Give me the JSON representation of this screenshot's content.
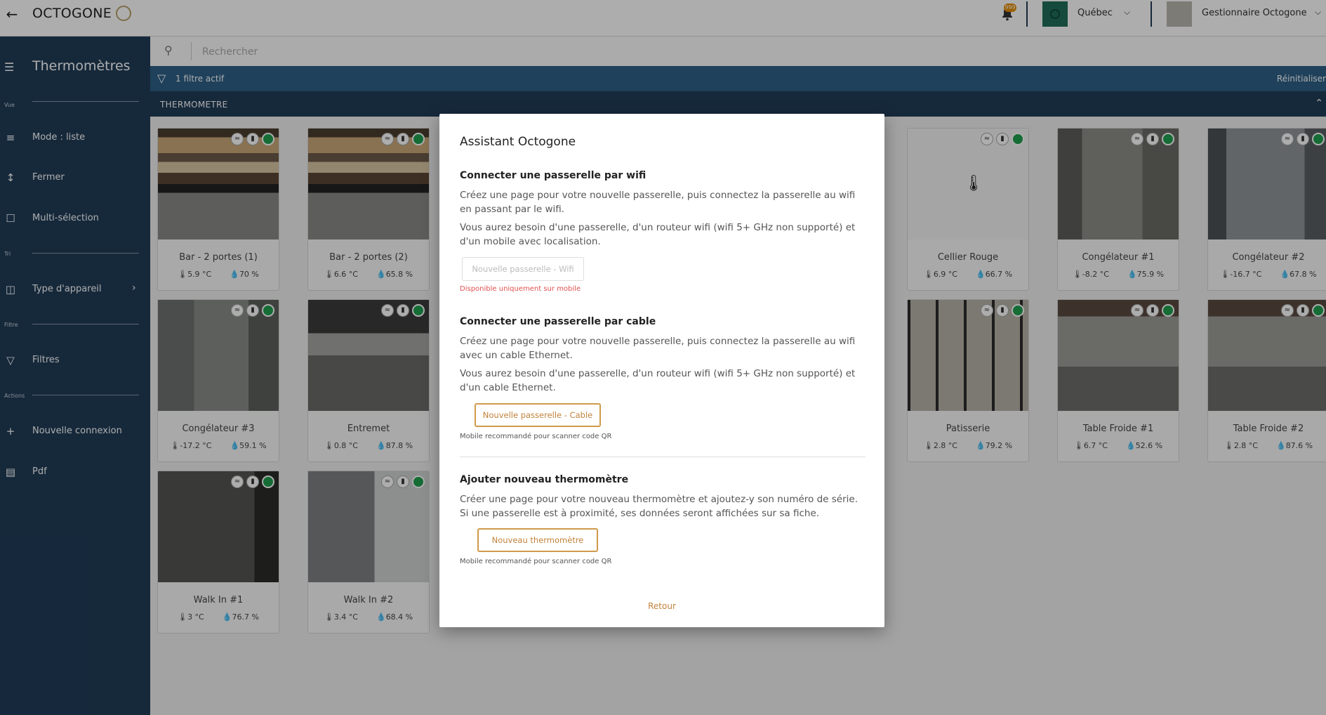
{
  "app": {
    "logo_text": "OCTOGONE",
    "notification_badge": "999",
    "region": "Québec",
    "user": "Gestionnaire Octogone"
  },
  "sidebar": {
    "title": "Thermomètres",
    "sections": {
      "vue": "Vue",
      "tri": "Tri",
      "filtre": "Filtre",
      "actions": "Actions"
    },
    "items": [
      {
        "label": "Mode : liste",
        "icon": "list-icon"
      },
      {
        "label": "Fermer",
        "icon": "collapse-icon"
      },
      {
        "label": "Multi-sélection",
        "icon": "checkbox-icon"
      },
      {
        "label": "Type d'appareil",
        "icon": "devices-icon"
      },
      {
        "label": "Filtres",
        "icon": "filter-icon"
      },
      {
        "label": "Nouvelle connexion",
        "icon": "plus-icon"
      },
      {
        "label": "Pdf",
        "icon": "pdf-icon"
      }
    ]
  },
  "search": {
    "placeholder": "Rechercher"
  },
  "filter_bar": {
    "label": "1 filtre actif",
    "reset": "Réinitialiser"
  },
  "group": {
    "label": "THERMOMETRE"
  },
  "cards": [
    {
      "name": "Bar - 2 portes (1)",
      "temp": "5.9 °C",
      "humidity": "70 %",
      "photo": "bar"
    },
    {
      "name": "Bar - 2 portes (2)",
      "temp": "6.6 °C",
      "humidity": "65.8 %",
      "photo": "bar"
    },
    {
      "name": "Cellier Rouge",
      "temp": "6.9 °C",
      "humidity": "66.7 %",
      "photo": "none"
    },
    {
      "name": "Congélateur #1",
      "temp": "-8.2 °C",
      "humidity": "75.9 %",
      "photo": "room"
    },
    {
      "name": "Congélateur #2",
      "temp": "-16.7 °C",
      "humidity": "67.8 %",
      "photo": "room"
    },
    {
      "name": "Congélateur #3",
      "temp": "-17.2 °C",
      "humidity": "59.1 %",
      "photo": "door"
    },
    {
      "name": "Entremet",
      "temp": "0.8 °C",
      "humidity": "87.8 %",
      "photo": "steel"
    },
    {
      "name": "Patisserie",
      "temp": "2.8 °C",
      "humidity": "79.2 %",
      "photo": "fridge"
    },
    {
      "name": "Table Froide #1",
      "temp": "6.7 °C",
      "humidity": "52.6 %",
      "photo": "steel"
    },
    {
      "name": "Table Froide #2",
      "temp": "2.8 °C",
      "humidity": "87.6 %",
      "photo": "steel"
    },
    {
      "name": "Walk In #1",
      "temp": "3 °C",
      "humidity": "76.7 %",
      "photo": "door"
    },
    {
      "name": "Walk In #2",
      "temp": "3.4 °C",
      "humidity": "68.4 %",
      "photo": "door2"
    }
  ],
  "modal": {
    "title": "Assistant Octogone",
    "wifi": {
      "heading": "Connecter une passerelle par wifi",
      "p1": "Créez une page pour votre nouvelle passerelle, puis connectez la passerelle au wifi en passant par le wifi.",
      "p2": "Vous aurez besoin d'une passerelle, d'un routeur wifi (wifi 5+ GHz non supporté) et d'un mobile avec localisation.",
      "button": "Nouvelle passerelle - Wifi",
      "error": "Disponible uniquement sur mobile"
    },
    "cable": {
      "heading": "Connecter une passerelle par cable",
      "p1": "Créez une page pour votre nouvelle passerelle, puis connectez la passerelle au wifi avec un cable Ethernet.",
      "p2": "Vous aurez besoin d'une passerelle, d'un routeur wifi (wifi 5+ GHz non supporté) et d'un cable Ethernet.",
      "button": "Nouvelle passerelle - Cable",
      "note": "Mobile recommandé pour scanner code QR"
    },
    "thermo": {
      "heading": "Ajouter nouveau thermomètre",
      "p1": "Créer une page pour votre nouveau thermomètre et ajoutez-y son numéro de série. Si une passerelle est à proximité, ses données seront affichées sur sa fiche.",
      "button": "Nouveau thermomètre",
      "note": "Mobile recommandé pour scanner code QR"
    },
    "back": "Retour"
  },
  "colors": {
    "sidebar": "#213d58",
    "filter_bar": "#2e6187",
    "accent": "#c2823a",
    "status_ok": "#1fa04e",
    "error": "#e0504d"
  }
}
